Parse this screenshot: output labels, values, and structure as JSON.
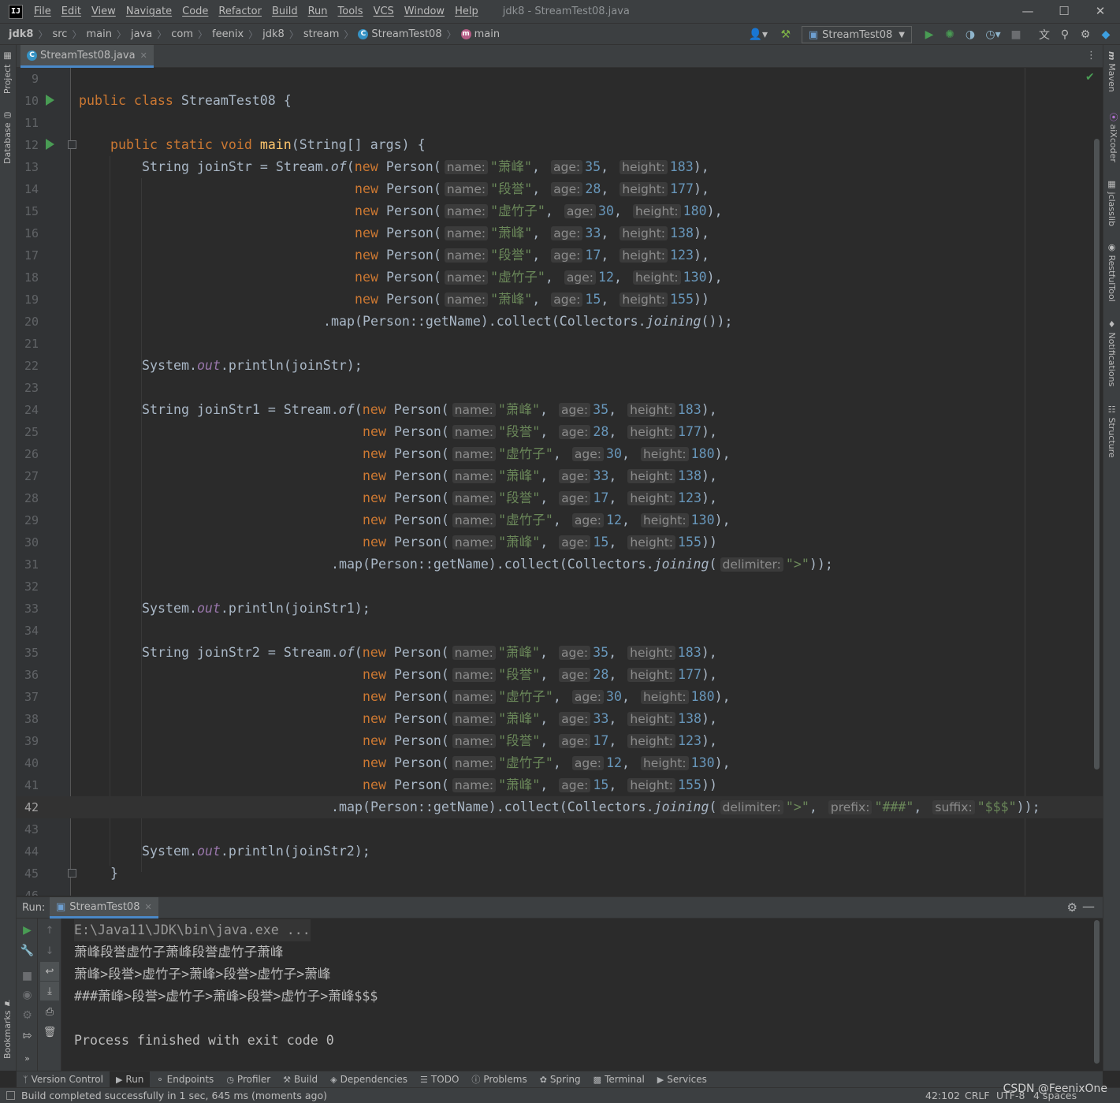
{
  "menubar": {
    "logo": "IJ",
    "items": [
      "File",
      "Edit",
      "View",
      "Navigate",
      "Code",
      "Refactor",
      "Build",
      "Run",
      "Tools",
      "VCS",
      "Window",
      "Help"
    ],
    "window_title": "jdk8 - StreamTest08.java"
  },
  "breadcrumbs": [
    "jdk8",
    "src",
    "main",
    "java",
    "com",
    "feenix",
    "jdk8",
    "stream",
    "StreamTest08",
    "main"
  ],
  "toolbar": {
    "run_config": "StreamTest08"
  },
  "left_tabs": [
    "Project",
    "Database",
    "Bookmarks"
  ],
  "right_tabs": [
    "Maven",
    "aiXcoder",
    "jclasslib",
    "RestfulTool",
    "Notifications",
    "Structure"
  ],
  "editor": {
    "tab_label": "StreamTest08.java",
    "lines": [
      "9",
      "10",
      "11",
      "12",
      "13",
      "14",
      "15",
      "16",
      "17",
      "18",
      "19",
      "20",
      "21",
      "22",
      "23",
      "24",
      "25",
      "26",
      "27",
      "28",
      "29",
      "30",
      "31",
      "32",
      "33",
      "34",
      "35",
      "36",
      "37",
      "38",
      "39",
      "40",
      "41",
      "42",
      "43",
      "44",
      "45",
      "46"
    ],
    "current_line": "42",
    "hints": {
      "name": "name:",
      "age": "age:",
      "height": "height:",
      "delimiter": "delimiter:",
      "prefix": "prefix:",
      "suffix": "suffix:"
    },
    "code": {
      "class_kw": "public class",
      "class_name": "StreamTest08",
      "brace_open": " {",
      "main_kw": "public static void",
      "main_name": "main",
      "main_args": "(String[] args) {",
      "decl1": "String joinStr = Stream.",
      "decl2": "String joinStr1 = Stream.",
      "decl3": "String joinStr2 = Stream.",
      "of": "of",
      "new_kw": "new",
      "person_open": "Person(",
      "persons": [
        {
          "name": "\"萧峰\"",
          "age": "35",
          "height": "183"
        },
        {
          "name": "\"段誉\"",
          "age": "28",
          "height": "177"
        },
        {
          "name": "\"虚竹子\"",
          "age": "30",
          "height": "180"
        },
        {
          "name": "\"萧峰\"",
          "age": "33",
          "height": "138"
        },
        {
          "name": "\"段誉\"",
          "age": "17",
          "height": "123"
        },
        {
          "name": "\"虚竹子\"",
          "age": "12",
          "height": "130"
        },
        {
          "name": "\"萧峰\"",
          "age": "15",
          "height": "155"
        }
      ],
      "comma": ",",
      "row_end": "),",
      "last_end": "))",
      "map_part": ".map(Person::getName).collect(Collectors.",
      "joining": "joining",
      "end1": "());",
      "delim_str": "\">\"",
      "prefix_str": "\"###\"",
      "suffix_str": "\"$$$\"",
      "end2": "));",
      "print_start": "System.",
      "out": "out",
      "print1": ".println(joinStr);",
      "print2": ".println(joinStr1);",
      "print3": ".println(joinStr2);",
      "close_brace": "}"
    }
  },
  "run": {
    "label": "Run:",
    "tab_label": "StreamTest08",
    "output": [
      "E:\\Java11\\JDK\\bin\\java.exe ...",
      "萧峰段誉虚竹子萧峰段誉虚竹子萧峰",
      "萧峰>段誉>虚竹子>萧峰>段誉>虚竹子>萧峰",
      "###萧峰>段誉>虚竹子>萧峰>段誉>虚竹子>萧峰$$$",
      "",
      "Process finished with exit code 0"
    ]
  },
  "bottom_tools": [
    "Version Control",
    "Run",
    "Endpoints",
    "Profiler",
    "Build",
    "Dependencies",
    "TODO",
    "Problems",
    "Spring",
    "Terminal",
    "Services"
  ],
  "status": {
    "message": "Build completed successfully in 1 sec, 645 ms (moments ago)",
    "position": "42:102",
    "line_sep": "CRLF",
    "encoding": "UTF-8",
    "indent": "4 spaces",
    "watermark": "CSDN @FeenixOne"
  },
  "colors": {
    "keyword": "#cc7832",
    "method": "#ffc66d",
    "number": "#6897bb",
    "string": "#6a8759",
    "field": "#9876aa",
    "text": "#a9b7c6",
    "run_green": "#499c54",
    "accent": "#4a88c7"
  }
}
